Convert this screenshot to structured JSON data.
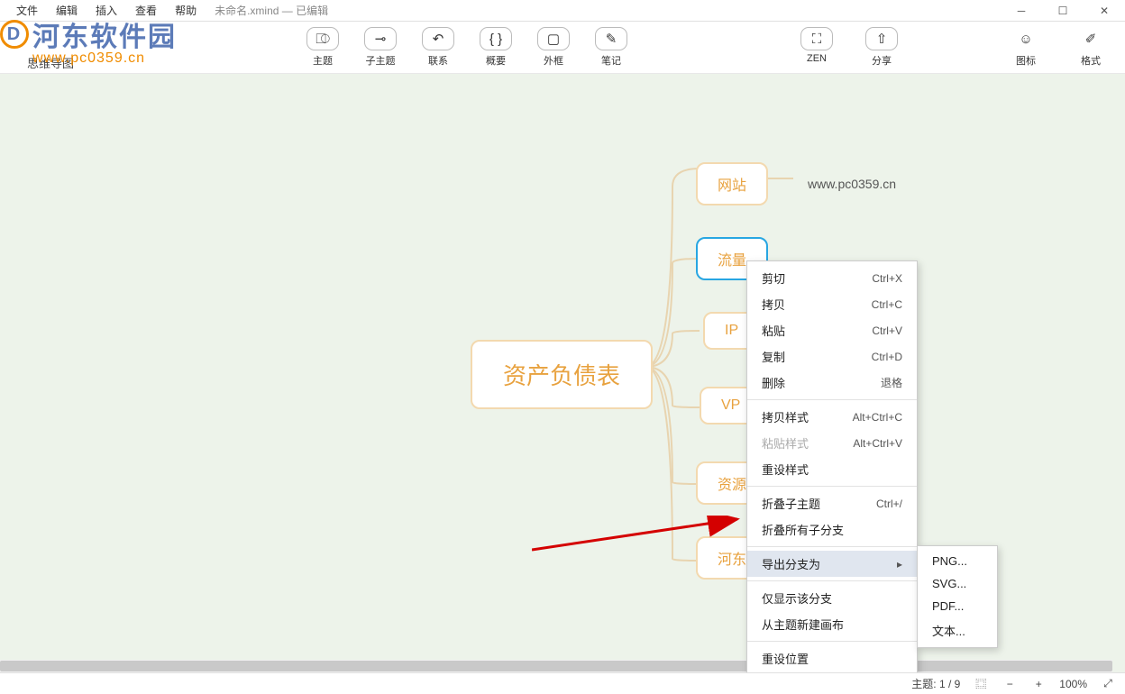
{
  "title": {
    "file": "未命名.xmind",
    "status": "已编辑"
  },
  "menu": {
    "items": [
      "文件",
      "编辑",
      "插入",
      "查看",
      "帮助"
    ]
  },
  "watermark": {
    "brand_cn": "河东软件园",
    "brand_en": "www.pc0359.cn",
    "logo_letter": "D"
  },
  "tab": {
    "label": "思维导图"
  },
  "toolbar": {
    "topic": "主题",
    "subtopic": "子主题",
    "relation": "联系",
    "summary": "概要",
    "boundary": "外框",
    "note": "笔记",
    "zen": "ZEN",
    "share": "分享",
    "iconset": "图标",
    "format": "格式"
  },
  "nodes": {
    "center": "资产负债表",
    "n1": "网站",
    "n1v": "www.pc0359.cn",
    "n2": "流量",
    "n3": "IP",
    "n4": "VP",
    "n5": "资源",
    "n6": "河东"
  },
  "ctx": {
    "items": [
      {
        "label": "剪切",
        "sc": "Ctrl+X"
      },
      {
        "label": "拷贝",
        "sc": "Ctrl+C"
      },
      {
        "label": "粘贴",
        "sc": "Ctrl+V"
      },
      {
        "label": "复制",
        "sc": "Ctrl+D"
      },
      {
        "label": "删除",
        "sc": "退格"
      }
    ],
    "style": [
      {
        "label": "拷贝样式",
        "sc": "Alt+Ctrl+C"
      },
      {
        "label": "粘贴样式",
        "sc": "Alt+Ctrl+V",
        "disabled": true
      },
      {
        "label": "重设样式",
        "sc": ""
      }
    ],
    "fold": [
      {
        "label": "折叠子主题",
        "sc": "Ctrl+/"
      },
      {
        "label": "折叠所有子分支",
        "sc": ""
      }
    ],
    "export": {
      "label": "导出分支为"
    },
    "only": {
      "label": "仅显示该分支"
    },
    "newcanvas": {
      "label": "从主题新建画布"
    },
    "reset": {
      "label": "重设位置"
    },
    "formats": [
      "PNG...",
      "SVG...",
      "PDF...",
      "文本..."
    ]
  },
  "status": {
    "topic_label": "主题:",
    "topic_count": "1 / 9",
    "zoom": "100%"
  }
}
